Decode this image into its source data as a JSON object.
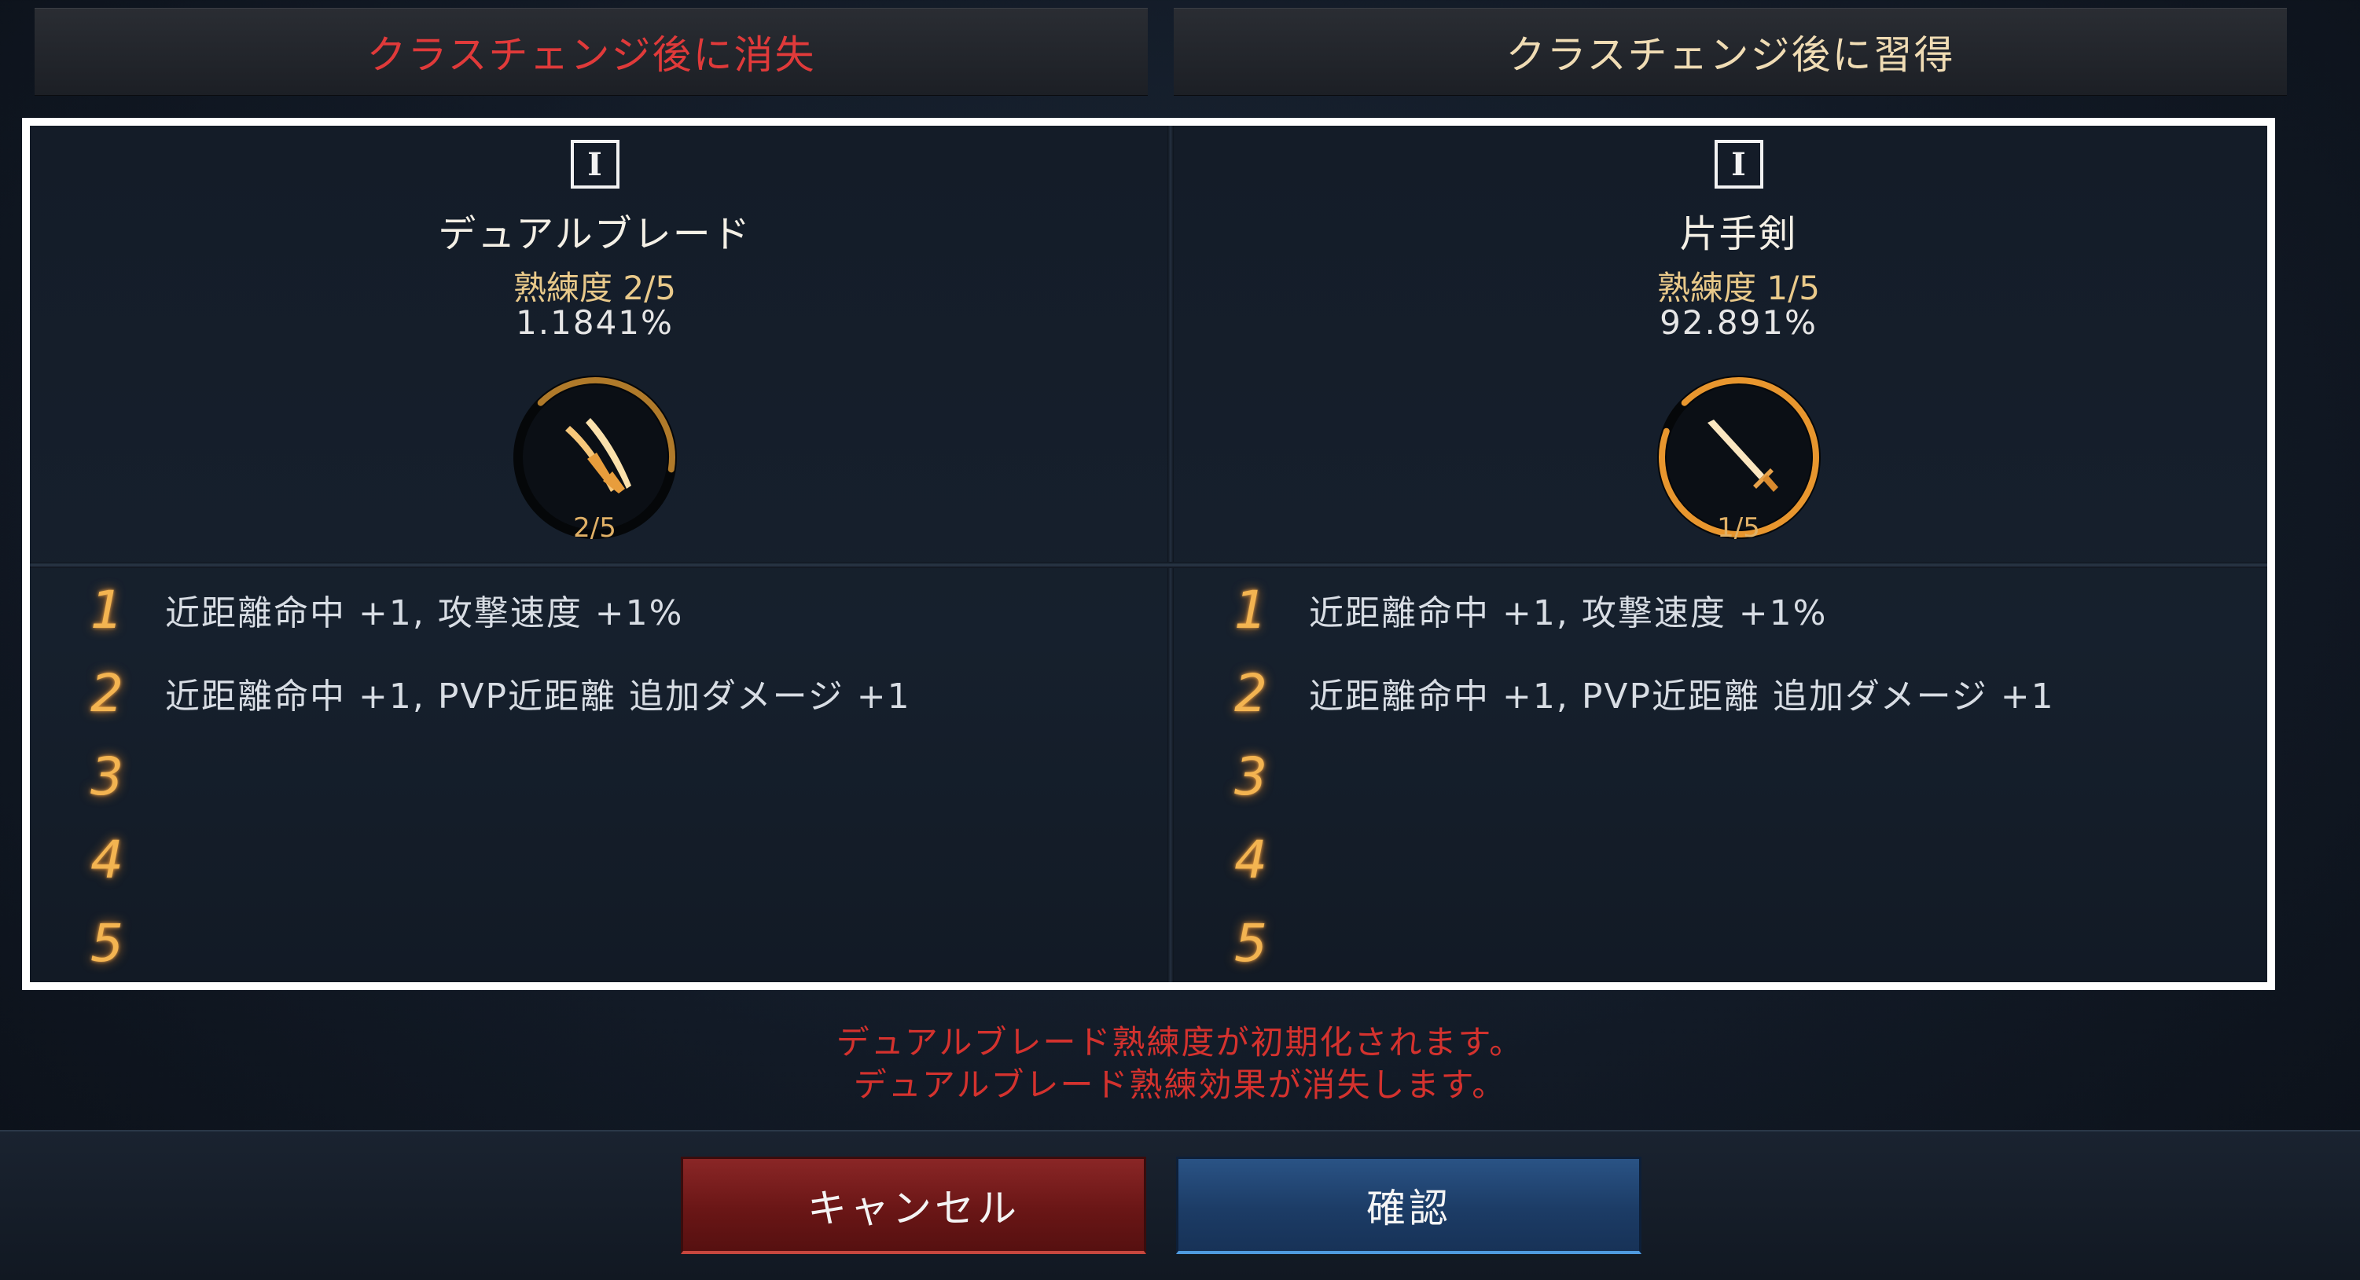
{
  "headers": {
    "lost": "クラスチェンジ後に消失",
    "gained": "クラスチェンジ後に習得"
  },
  "left": {
    "tier": "I",
    "weapon": "デュアルブレード",
    "proficiency": "熟練度 2/5",
    "percent": "1.1841%",
    "gauge_level": "2/5",
    "gauge_fraction": 0.4,
    "icon": "dual-blade-icon",
    "effects": [
      {
        "num": "1",
        "text": "近距離命中 +1,  攻撃速度 +1%"
      },
      {
        "num": "2",
        "text": "近距離命中 +1,  PVP近距離 追加ダメージ +1"
      },
      {
        "num": "3",
        "text": ""
      },
      {
        "num": "4",
        "text": ""
      },
      {
        "num": "5",
        "text": ""
      }
    ]
  },
  "right": {
    "tier": "I",
    "weapon": "片手剣",
    "proficiency": "熟練度 1/5",
    "percent": "92.891%",
    "gauge_level": "1/5",
    "gauge_fraction": 0.93,
    "icon": "one-handed-sword-icon",
    "effects": [
      {
        "num": "1",
        "text": "近距離命中 +1,  攻撃速度 +1%"
      },
      {
        "num": "2",
        "text": "近距離命中 +1,  PVP近距離 追加ダメージ +1"
      },
      {
        "num": "3",
        "text": ""
      },
      {
        "num": "4",
        "text": ""
      },
      {
        "num": "5",
        "text": ""
      }
    ]
  },
  "warning": {
    "line1": "デュアルブレード熟練度が初期化されます。",
    "line2": "デュアルブレード熟練効果が消失します。"
  },
  "buttons": {
    "cancel": "キャンセル",
    "confirm": "確認"
  },
  "colors": {
    "warning_red": "#d4322e",
    "gold": "#f3b451",
    "cancel_red": "#6a1616",
    "confirm_blue": "#1c3c66"
  }
}
